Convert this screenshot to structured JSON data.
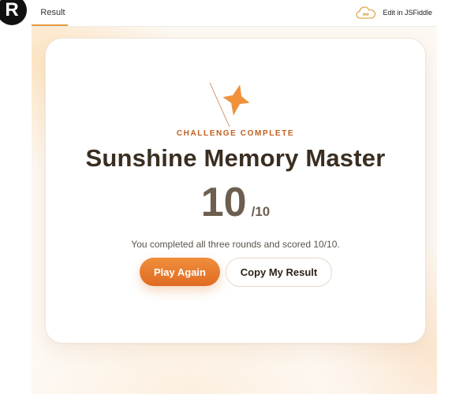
{
  "badge": {
    "letter": "R"
  },
  "tabs": {
    "result_label": "Result",
    "jsfiddle_label": "Edit in JSFiddle"
  },
  "icons": {
    "cloud": "cloud-icon",
    "spark": "sparkle-icon"
  },
  "colors": {
    "accent": "#e8983a",
    "kicker": "#c25f1f",
    "title": "#3a2e22",
    "spark": "#f0923a",
    "play_button_top": "#ef8f3c",
    "play_button_bottom": "#e06b21"
  },
  "card": {
    "kicker": "CHALLENGE COMPLETE",
    "title": "Sunshine Memory Master",
    "score": "10",
    "score_total": "/10",
    "message": "You completed all three rounds and scored 10/10.",
    "play_again_label": "Play Again",
    "copy_result_label": "Copy My Result"
  }
}
